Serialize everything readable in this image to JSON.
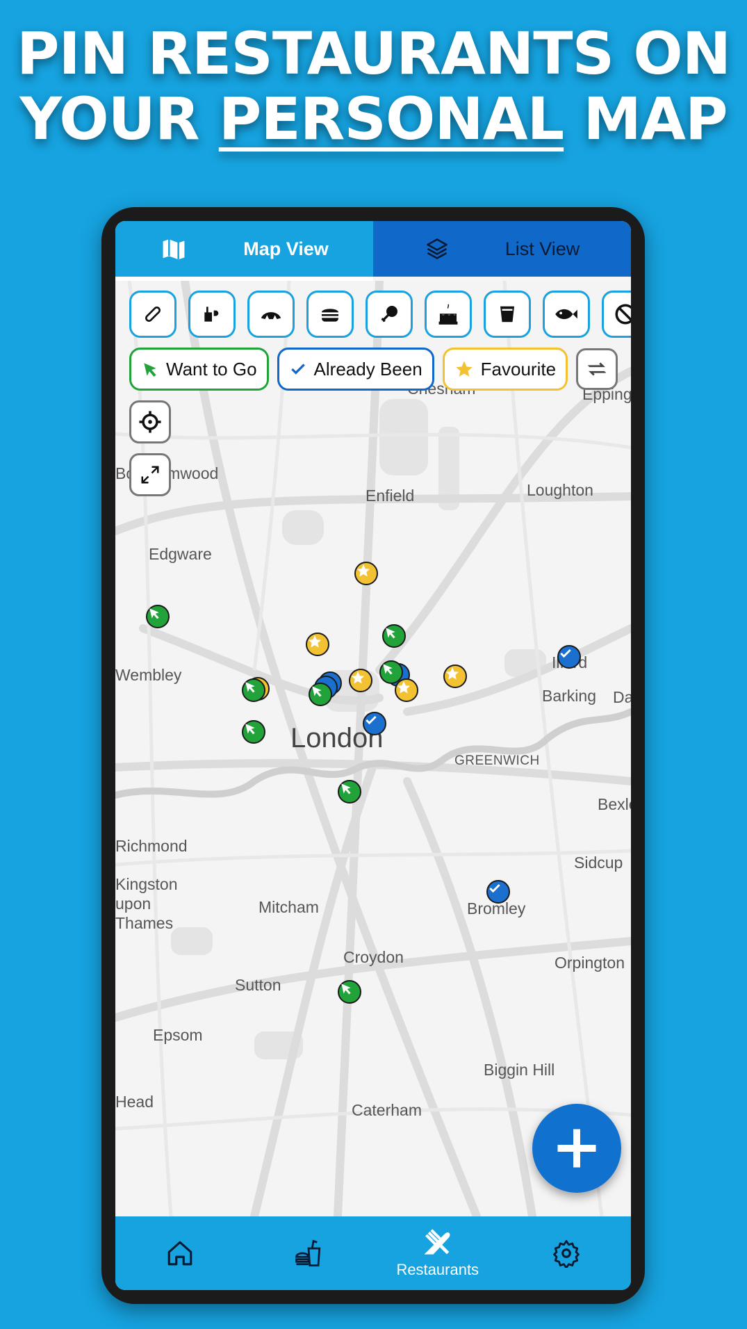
{
  "headline": {
    "line1": "PIN RESTAURANTS ON",
    "line2_prefix": "YOUR ",
    "line2_underlined": "PERSONAL",
    "line2_suffix": " MAP"
  },
  "tabs": [
    {
      "label": "Map View",
      "icon": "map-icon",
      "active": true
    },
    {
      "label": "List View",
      "icon": "layers-icon",
      "active": false
    }
  ],
  "categories": [
    "hotdog-icon",
    "coffee-icon",
    "croissant-icon",
    "burger-icon",
    "chicken-leg-icon",
    "cake-icon",
    "drink-icon",
    "fish-icon",
    "no-icon"
  ],
  "filters": [
    {
      "label": "Want to Go",
      "icon": "pin-icon",
      "color": "#21a33a"
    },
    {
      "label": "Already Been",
      "icon": "check-icon",
      "color": "#1168c9"
    },
    {
      "label": "Favourite",
      "icon": "star-icon",
      "color": "#f2c233"
    }
  ],
  "map": {
    "places": [
      "Enfield",
      "Loughton",
      "Edgware",
      "Ilford",
      "Barking",
      "London",
      "GREENWICH",
      "Mitcham",
      "Sidcup",
      "Croydon",
      "Sutton",
      "Orpington",
      "Epsom",
      "Caterham",
      "Bexle",
      "Chesham",
      "Epping",
      "Borehamwood",
      "Wembley",
      "Richmond",
      "Kingston upon Thames",
      "Bromley",
      "Biggin Hill",
      "Head",
      "Da"
    ]
  },
  "fab": {
    "icon": "plus-icon"
  },
  "bottom_nav": [
    {
      "icon": "home-icon",
      "label": ""
    },
    {
      "icon": "takeaway-icon",
      "label": ""
    },
    {
      "icon": "restaurants-icon",
      "label": "Restaurants"
    },
    {
      "icon": "settings-icon",
      "label": ""
    }
  ],
  "colors": {
    "background": "#16a3e0",
    "want": "#21a33a",
    "been": "#1a6fcf",
    "favourite": "#f2c233"
  }
}
